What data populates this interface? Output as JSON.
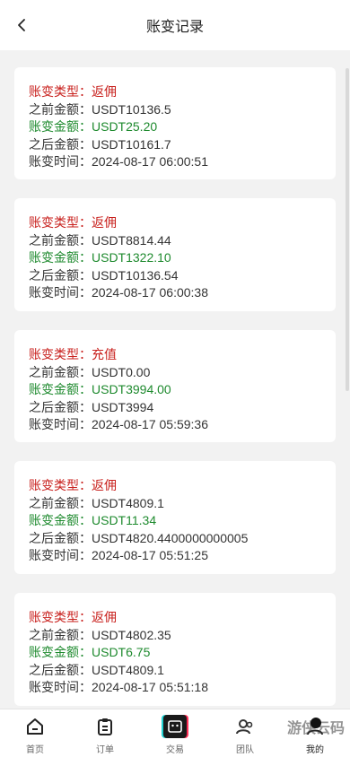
{
  "header": {
    "title": "账变记录"
  },
  "records": [
    {
      "type_label": "账变类型：",
      "type_value": "返佣",
      "before_label": "之前金额：",
      "before_value": "USDT10136.5",
      "change_label": "账变金额：",
      "change_value": "USDT25.20",
      "after_label": "之后金额：",
      "after_value": "USDT10161.7",
      "time_label": "账变时间：",
      "time_value": "2024-08-17 06:00:51"
    },
    {
      "type_label": "账变类型：",
      "type_value": "返佣",
      "before_label": "之前金额：",
      "before_value": "USDT8814.44",
      "change_label": "账变金额：",
      "change_value": "USDT1322.10",
      "after_label": "之后金额：",
      "after_value": "USDT10136.54",
      "time_label": "账变时间：",
      "time_value": "2024-08-17 06:00:38"
    },
    {
      "type_label": "账变类型：",
      "type_value": "充值",
      "before_label": "之前金额：",
      "before_value": "USDT0.00",
      "change_label": "账变金额：",
      "change_value": "USDT3994.00",
      "after_label": "之后金额：",
      "after_value": "USDT3994",
      "time_label": "账变时间：",
      "time_value": "2024-08-17 05:59:36"
    },
    {
      "type_label": "账变类型：",
      "type_value": "返佣",
      "before_label": "之前金额：",
      "before_value": "USDT4809.1",
      "change_label": "账变金额：",
      "change_value": "USDT11.34",
      "after_label": "之后金额：",
      "after_value": "USDT4820.4400000000005",
      "time_label": "账变时间：",
      "time_value": "2024-08-17 05:51:25"
    },
    {
      "type_label": "账变类型：",
      "type_value": "返佣",
      "before_label": "之前金额：",
      "before_value": "USDT4802.35",
      "change_label": "账变金额：",
      "change_value": "USDT6.75",
      "after_label": "之后金额：",
      "after_value": "USDT4809.1",
      "time_label": "账变时间：",
      "time_value": "2024-08-17 05:51:18"
    }
  ],
  "tabs": [
    {
      "label": "首页",
      "icon": "home-icon"
    },
    {
      "label": "订单",
      "icon": "clipboard-icon"
    },
    {
      "label": "交易",
      "icon": "trade-icon"
    },
    {
      "label": "团队",
      "icon": "team-icon"
    },
    {
      "label": "我的",
      "icon": "profile-icon"
    }
  ],
  "watermark": "游侠云码",
  "colors": {
    "type_and_label_red": "#c8201d",
    "amount_green": "#1e8a2e",
    "text": "#333333",
    "background": "#f2f2f2"
  }
}
